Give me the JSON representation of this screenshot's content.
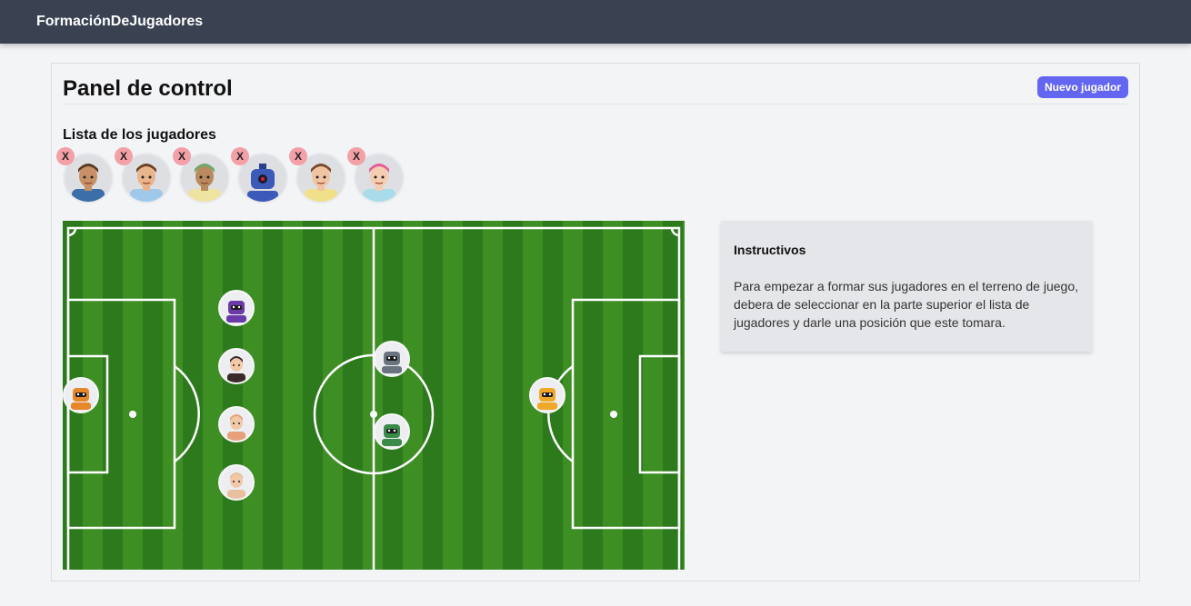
{
  "navbar": {
    "brand": "FormaciónDeJugadores"
  },
  "panel": {
    "title": "Panel de control",
    "new_player_button": "Nuevo jugador",
    "list_title": "Lista de los jugadores",
    "remove_label": "X",
    "players": [
      {
        "avatar": "bald-glasses-avatar",
        "skin": "#c89066",
        "hair": "#5a3c22",
        "shirt": "#3c6ea8"
      },
      {
        "avatar": "mustache-man-avatar",
        "skin": "#e8b48c",
        "hair": "#6b4226",
        "shirt": "#9fc8ea"
      },
      {
        "avatar": "turban-man-avatar",
        "skin": "#b98a5e",
        "hair": "#6fa86a",
        "shirt": "#efe3a2"
      },
      {
        "avatar": "blue-robot-avatar",
        "skin": "#3c5ab8",
        "hair": "#2a3f8a",
        "shirt": "#3c5ab8"
      },
      {
        "avatar": "curly-hair-avatar",
        "skin": "#f0c4a2",
        "hair": "#7a4a2a",
        "shirt": "#f1e08a"
      },
      {
        "avatar": "pink-hat-avatar",
        "skin": "#f5cdb0",
        "hair": "#e85a9a",
        "shirt": "#a8dcea"
      }
    ]
  },
  "field": {
    "players": [
      {
        "avatar": "orange-robot-avatar",
        "color": "#e8862a"
      },
      {
        "avatar": "purple-robot-avatar",
        "color": "#6a3aa8"
      },
      {
        "avatar": "braids-woman-avatar",
        "color": "#3a2a2a"
      },
      {
        "avatar": "red-hair-man-avatar",
        "color": "#e7a07a"
      },
      {
        "avatar": "eyepatch-man-avatar",
        "color": "#e8c0a0"
      },
      {
        "avatar": "grey-robot-avatar",
        "color": "#6a7480"
      },
      {
        "avatar": "green-robot-avatar",
        "color": "#3a8a4a"
      },
      {
        "avatar": "yellow-robot-avatar",
        "color": "#f0a828"
      }
    ]
  },
  "instructions": {
    "title": "Instructivos",
    "body": "Para empezar a formar sus jugadores en el terreno de juego, debera de seleccionar en la parte superior el lista de jugadores y darle una posición que este tomara."
  }
}
